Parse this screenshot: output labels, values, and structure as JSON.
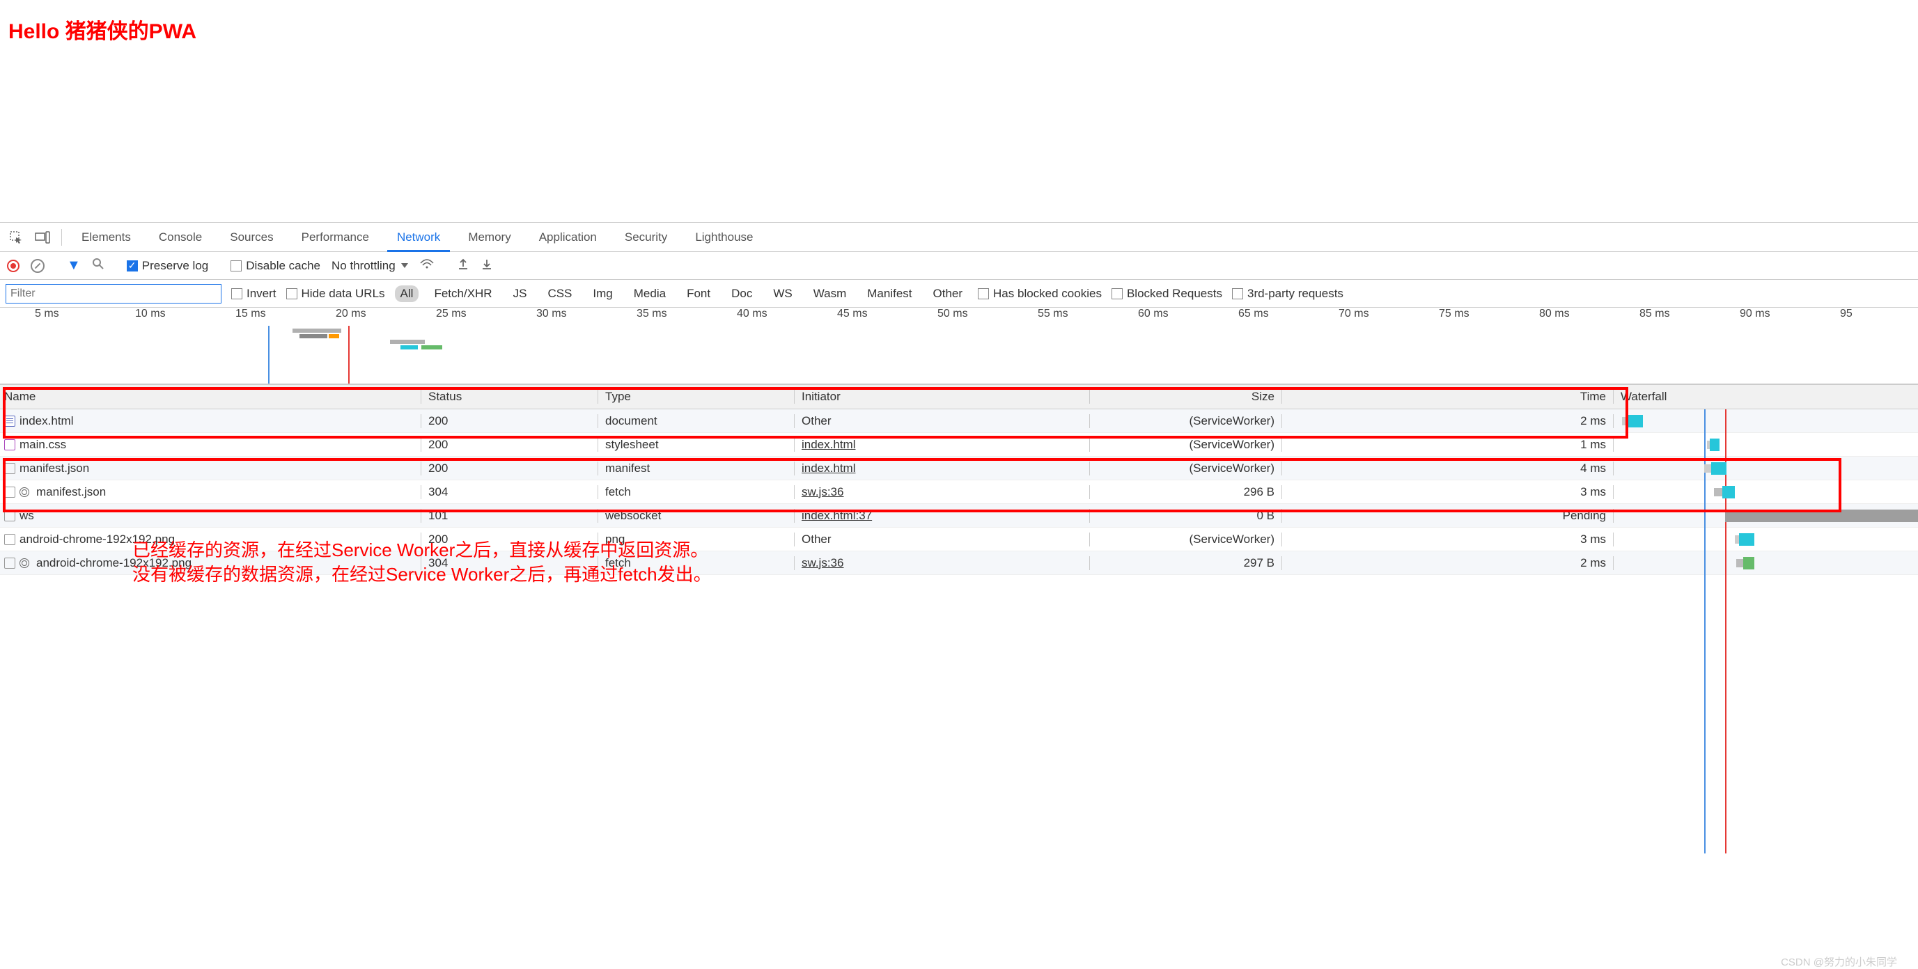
{
  "page_title": "Hello 猪猪侠的PWA",
  "tabs": {
    "elements": "Elements",
    "console": "Console",
    "sources": "Sources",
    "performance": "Performance",
    "network": "Network",
    "memory": "Memory",
    "application": "Application",
    "security": "Security",
    "lighthouse": "Lighthouse"
  },
  "toolbar": {
    "preserve_log": "Preserve log",
    "disable_cache": "Disable cache",
    "throttling": "No throttling"
  },
  "filter_bar": {
    "filter_placeholder": "Filter",
    "invert": "Invert",
    "hide_data_urls": "Hide data URLs",
    "chips": {
      "all": "All",
      "fetch_xhr": "Fetch/XHR",
      "js": "JS",
      "css": "CSS",
      "img": "Img",
      "media": "Media",
      "font": "Font",
      "doc": "Doc",
      "ws": "WS",
      "wasm": "Wasm",
      "manifest": "Manifest",
      "other": "Other"
    },
    "has_blocked_cookies": "Has blocked cookies",
    "blocked_requests": "Blocked Requests",
    "third_party": "3rd-party requests"
  },
  "timeline_ticks": [
    "5 ms",
    "10 ms",
    "15 ms",
    "20 ms",
    "25 ms",
    "30 ms",
    "35 ms",
    "40 ms",
    "45 ms",
    "50 ms",
    "55 ms",
    "60 ms",
    "65 ms",
    "70 ms",
    "75 ms",
    "80 ms",
    "85 ms",
    "90 ms",
    "95"
  ],
  "columns": {
    "name": "Name",
    "status": "Status",
    "type": "Type",
    "initiator": "Initiator",
    "size": "Size",
    "time": "Time",
    "waterfall": "Waterfall"
  },
  "rows": [
    {
      "name": "index.html",
      "status": "200",
      "type": "document",
      "initiator": "Other",
      "initiator_link": false,
      "size": "(ServiceWorker)",
      "time": "2 ms",
      "icon": "doc",
      "gear": false
    },
    {
      "name": "main.css",
      "status": "200",
      "type": "stylesheet",
      "initiator": "index.html",
      "initiator_link": true,
      "size": "(ServiceWorker)",
      "time": "1 ms",
      "icon": "css",
      "gear": false
    },
    {
      "name": "manifest.json",
      "status": "200",
      "type": "manifest",
      "initiator": "index.html",
      "initiator_link": true,
      "size": "(ServiceWorker)",
      "time": "4 ms",
      "icon": "generic",
      "gear": false
    },
    {
      "name": "manifest.json",
      "status": "304",
      "type": "fetch",
      "initiator": "sw.js:36",
      "initiator_link": true,
      "size": "296 B",
      "time": "3 ms",
      "icon": "generic",
      "gear": true
    },
    {
      "name": "ws",
      "status": "101",
      "type": "websocket",
      "initiator": "index.html:37",
      "initiator_link": true,
      "size": "0 B",
      "time": "Pending",
      "icon": "generic",
      "gear": false
    },
    {
      "name": "android-chrome-192x192.png",
      "status": "200",
      "type": "png",
      "initiator": "Other",
      "initiator_link": false,
      "size": "(ServiceWorker)",
      "time": "3 ms",
      "icon": "generic",
      "gear": false
    },
    {
      "name": "android-chrome-192x192.png",
      "status": "304",
      "type": "fetch",
      "initiator": "sw.js:36",
      "initiator_link": true,
      "size": "297 B",
      "time": "2 ms",
      "icon": "generic",
      "gear": true
    }
  ],
  "annotations": {
    "line1": "已经缓存的资源，在经过Service Worker之后，直接从缓存中返回资源。",
    "line2": "没有被缓存的数据资源，在经过Service Worker之后，再通过fetch发出。"
  },
  "watermark": "CSDN @努力的小朱同学"
}
